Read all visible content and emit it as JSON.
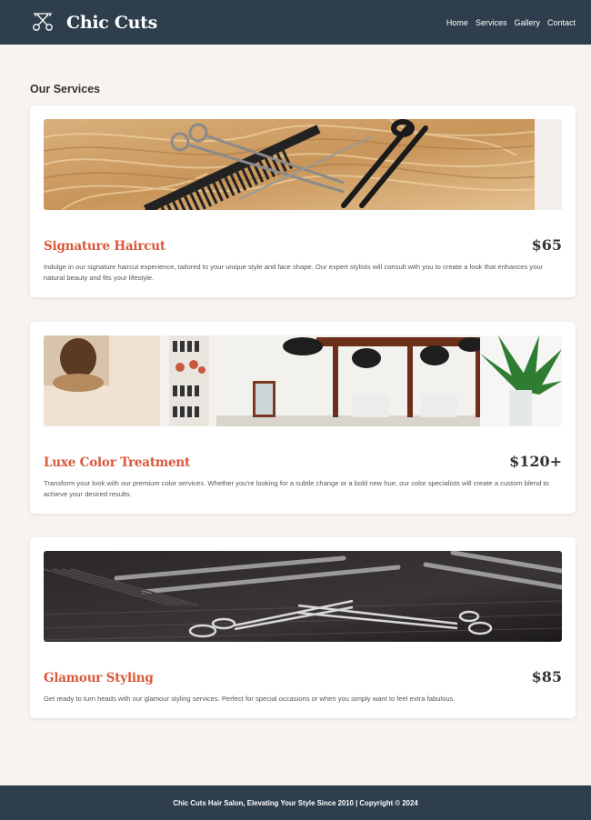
{
  "header": {
    "title": "Chic Cuts",
    "nav": [
      "Home",
      "Services",
      "Gallery",
      "Contact"
    ]
  },
  "services_section": {
    "title": "Our Services",
    "items": [
      {
        "name": "Signature Haircut",
        "price": "$65",
        "description": "Indulge in our signature haircut experience, tailored to your unique style and face shape. Our expert stylists will consult with you to create a look that enhances your natural beauty and fits your lifestyle."
      },
      {
        "name": "Luxe Color Treatment",
        "price": "$120+",
        "description": "Transform your look with our premium color services. Whether you're looking for a subtle change or a bold new hue, our color specialists will create a custom blend to achieve your desired results."
      },
      {
        "name": "Glamour Styling",
        "price": "$85",
        "description": "Get ready to turn heads with our glamour styling services. Perfect for special occasions or when you simply want to feel extra fabulous."
      }
    ]
  },
  "footer": {
    "text": "Chic Cuts Hair Salon, Elevating Your Style Since 2010 | Copyright © 2024"
  },
  "colors": {
    "header_bg": "#2e3e4c",
    "accent": "#d9573a",
    "page_bg": "#f7f4ef"
  },
  "icons": {
    "logo": "scissors-comb-icon"
  }
}
